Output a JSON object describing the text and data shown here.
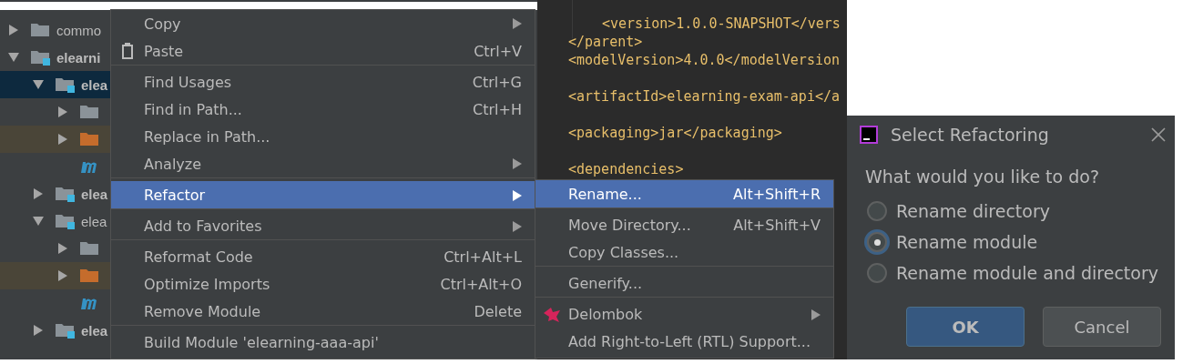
{
  "project_tree": [
    {
      "kind": "folder",
      "label": "commo",
      "expanded": false,
      "selected": false,
      "bold": false
    },
    {
      "kind": "module",
      "label": "elearni",
      "expanded": true,
      "selected": false,
      "bold": true,
      "children": [
        {
          "kind": "module",
          "label": "elea",
          "expanded": true,
          "selected": true,
          "bold": true,
          "children": [
            {
              "kind": "folder",
              "expanded": false,
              "selected": false
            },
            {
              "kind": "excluded-folder",
              "expanded": false,
              "selected": false
            },
            {
              "kind": "pom",
              "selected": false
            }
          ]
        },
        {
          "kind": "module",
          "label": "elea",
          "expanded": false,
          "selected": false,
          "bold": true
        },
        {
          "kind": "module",
          "label": "elea",
          "expanded": true,
          "selected": false,
          "bold": false,
          "children": [
            {
              "kind": "folder",
              "expanded": false,
              "selected": false
            },
            {
              "kind": "excluded-folder",
              "expanded": false,
              "selected": false
            },
            {
              "kind": "pom",
              "selected": false
            }
          ]
        },
        {
          "kind": "module",
          "label": "elea",
          "expanded": false,
          "selected": false,
          "bold": true
        }
      ]
    }
  ],
  "code_lines": [
    {
      "text": "<version>1.0.0-SNAPSHOT</vers",
      "indented": true,
      "blank_before": false
    },
    {
      "text": "</parent>",
      "indented": false,
      "blank_before": false
    },
    {
      "text": "<modelVersion>4.0.0</modelVersion",
      "indented": false,
      "blank_before": false
    },
    {
      "text": "<artifactId>elearning-exam-api</a",
      "indented": false,
      "blank_before": true
    },
    {
      "text": "<packaging>jar</packaging>",
      "indented": false,
      "blank_before": true
    },
    {
      "text": "<dependencies>",
      "indented": false,
      "blank_before": true
    }
  ],
  "context_menu": [
    {
      "kind": "plain",
      "label": "Copy",
      "submenu": true,
      "selected": false,
      "separator_before": false
    },
    {
      "kind": "paste",
      "label": "Paste",
      "shortcut": "Ctrl+V",
      "submenu": false,
      "selected": false,
      "separator_before": false
    },
    {
      "kind": "plain",
      "label": "Find Usages",
      "shortcut": "Ctrl+G",
      "submenu": false,
      "selected": false,
      "separator_before": true
    },
    {
      "kind": "plain",
      "label": "Find in Path...",
      "shortcut": "Ctrl+H",
      "submenu": false,
      "selected": false,
      "separator_before": false
    },
    {
      "kind": "plain",
      "label": "Replace in Path...",
      "submenu": false,
      "selected": false,
      "separator_before": false
    },
    {
      "kind": "plain",
      "label": "Analyze",
      "submenu": true,
      "selected": false,
      "separator_before": false
    },
    {
      "kind": "plain",
      "label": "Refactor",
      "submenu": true,
      "selected": true,
      "separator_before": true
    },
    {
      "kind": "plain",
      "label": "Add to Favorites",
      "submenu": true,
      "selected": false,
      "separator_before": true
    },
    {
      "kind": "plain",
      "label": "Reformat Code",
      "shortcut": "Ctrl+Alt+L",
      "submenu": false,
      "selected": false,
      "separator_before": true
    },
    {
      "kind": "plain",
      "label": "Optimize Imports",
      "shortcut": "Ctrl+Alt+O",
      "submenu": false,
      "selected": false,
      "separator_before": false
    },
    {
      "kind": "plain",
      "label": "Remove Module",
      "shortcut": "Delete",
      "submenu": false,
      "selected": false,
      "separator_before": false
    },
    {
      "kind": "plain",
      "label": "Build Module 'elearning-aaa-api'",
      "submenu": false,
      "selected": false,
      "separator_before": true
    }
  ],
  "refactor_submenu": [
    {
      "kind": "plain",
      "label": "Rename...",
      "shortcut": "Alt+Shift+R",
      "submenu": false,
      "selected": true,
      "separator_before": false
    },
    {
      "kind": "plain",
      "label": "Move Directory...",
      "shortcut": "Alt+Shift+V",
      "submenu": false,
      "selected": false,
      "separator_before": true
    },
    {
      "kind": "plain",
      "label": "Copy Classes...",
      "submenu": false,
      "selected": false,
      "separator_before": false
    },
    {
      "kind": "plain",
      "label": "Generify...",
      "submenu": false,
      "selected": false,
      "separator_before": true
    },
    {
      "kind": "lombok",
      "label": "Delombok",
      "submenu": true,
      "selected": false,
      "separator_before": true
    },
    {
      "kind": "plain",
      "label": "Add Right-to-Left (RTL) Support...",
      "submenu": false,
      "selected": false,
      "separator_before": false
    }
  ],
  "dialog": {
    "title": "Select Refactoring",
    "question": "What would you like to do?",
    "options": [
      {
        "label": "Rename directory",
        "selected": false
      },
      {
        "label": "Rename module",
        "selected": true
      },
      {
        "label": "Rename module and directory",
        "selected": false
      }
    ],
    "buttons": [
      {
        "label": "OK",
        "default": true
      },
      {
        "label": "Cancel",
        "default": false
      }
    ]
  }
}
